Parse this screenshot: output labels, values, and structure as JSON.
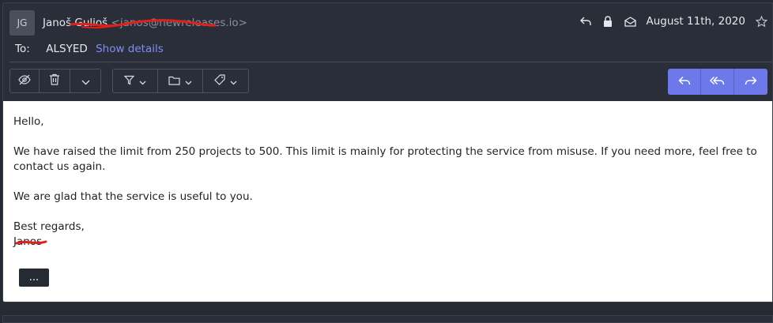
{
  "header": {
    "avatar_initials": "JG",
    "sender_name": "Janoš Gulioš",
    "sender_address": "<janos@newreleases.io>",
    "date": "August 11th, 2020",
    "to_label": "To:",
    "to_value": "ALSYED",
    "show_details": "Show details"
  },
  "icons": {
    "reply_small": "reply-icon",
    "lock": "lock-icon",
    "envelope": "envelope-open-icon",
    "star": "star-icon",
    "mark_unread": "eye-slash-icon",
    "trash": "trash-icon",
    "more": "chevron-down-icon",
    "filter": "filter-icon",
    "move": "folder-icon",
    "label": "tag-icon",
    "reply": "reply-icon",
    "reply_all": "reply-all-icon",
    "forward": "forward-icon"
  },
  "body": {
    "greeting": "Hello,",
    "paragraph1": "We have raised the limit from 250 projects to 500. This limit is mainly for protecting the service from misuse. If you need more, feel free to contact us again.",
    "paragraph2": "We are glad that the service is useful to you.",
    "closing": "Best regards,",
    "signature": "Janos",
    "more_label": "..."
  },
  "colors": {
    "accent": "#6d79e8",
    "link": "#7d8ef5",
    "redaction": "#e0201a"
  }
}
